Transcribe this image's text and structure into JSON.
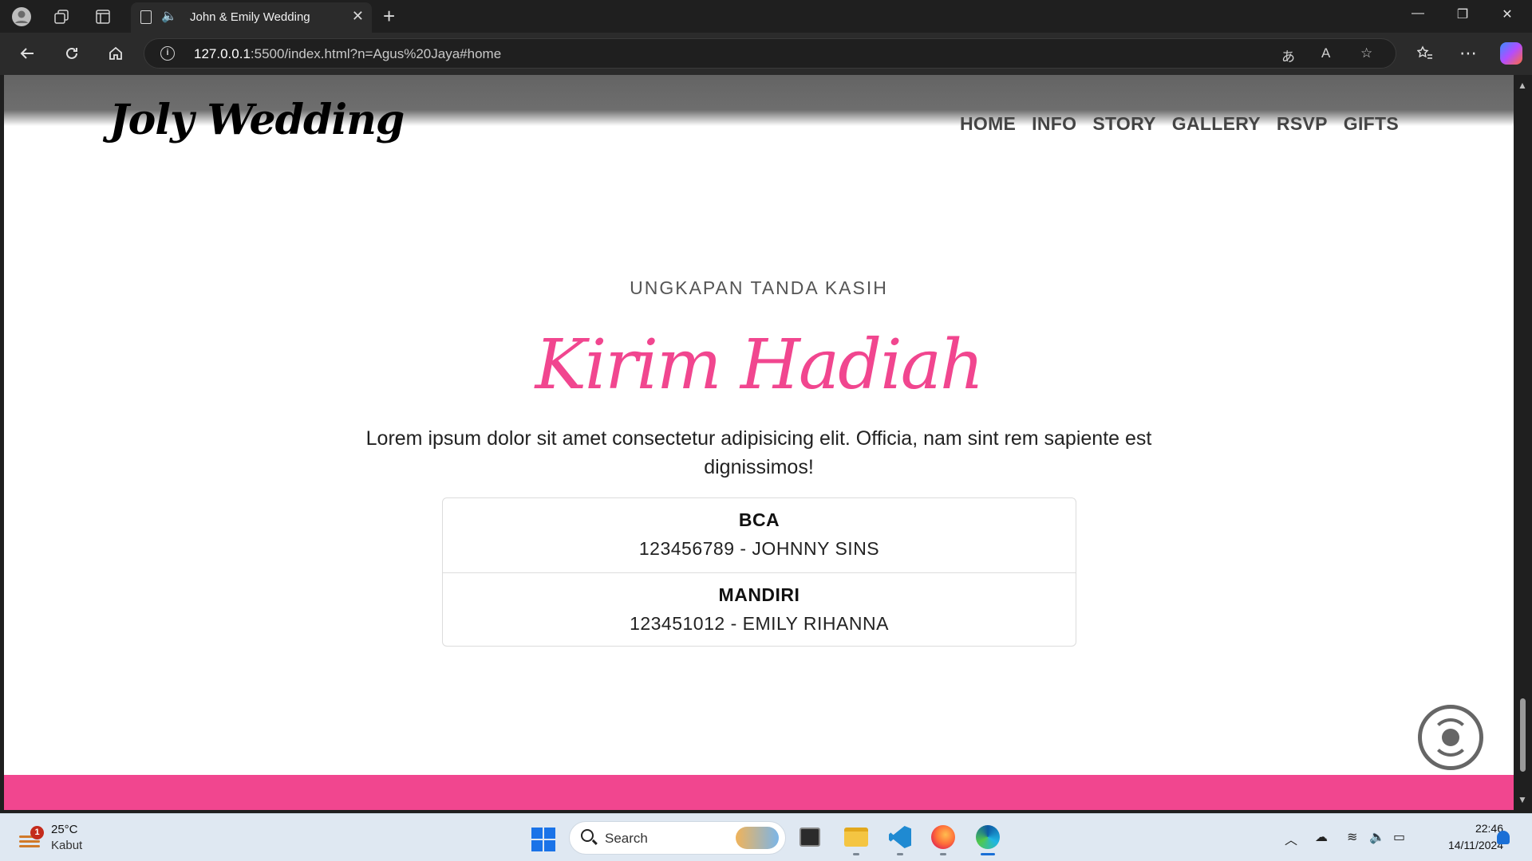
{
  "browser": {
    "tab_title": "John & Emily Wedding",
    "url_host": "127.0.0.1",
    "url_rest": ":5500/index.html?n=Agus%20Jaya#home"
  },
  "site": {
    "logo": "Joly Wedding",
    "nav": [
      "HOME",
      "INFO",
      "STORY",
      "GALLERY",
      "RSVP",
      "GIFTS"
    ]
  },
  "gifts": {
    "eyebrow": "UNGKAPAN TANDA KASIH",
    "title": "Kirim Hadiah",
    "description": "Lorem ipsum dolor sit amet consectetur adipisicing elit. Officia, nam sint rem sapiente est dignissimos!",
    "accounts": [
      {
        "bank": "BCA",
        "detail": "123456789 - JOHNNY SINS"
      },
      {
        "bank": "MANDIRI",
        "detail": "123451012 - EMILY RIHANNA"
      }
    ]
  },
  "colors": {
    "accent": "#f1468f",
    "browser_chrome": "#1f1f1f"
  },
  "taskbar": {
    "weather_temp": "25°C",
    "weather_desc": "Kabut",
    "weather_badge": "1",
    "search_label": "Search",
    "time": "22:46",
    "date": "14/11/2024"
  }
}
